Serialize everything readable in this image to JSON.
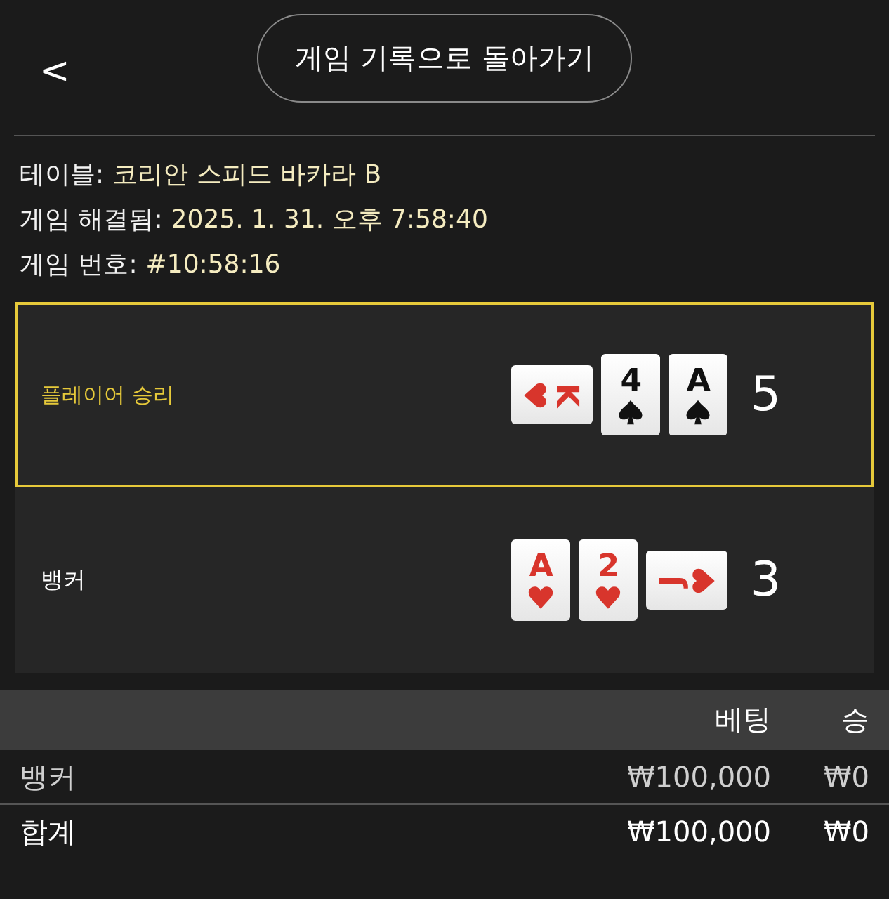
{
  "header": {
    "back": "<",
    "title": "게임 기록으로 돌아가기"
  },
  "info": [
    {
      "label": "테이블:",
      "value": "코리안 스피드 바카라 B"
    },
    {
      "label": "게임 해결됨:",
      "value": "2025. 1. 31. 오후 7:58:40"
    },
    {
      "label": "게임 번호:",
      "value": "#10:58:16"
    }
  ],
  "hands": [
    {
      "name": "플레이어 승리",
      "winner": true,
      "score": "5",
      "cards": [
        {
          "rank": "K",
          "kind": "heart",
          "turned_right": true,
          "turned_left": false
        },
        {
          "rank": "4",
          "kind": "spade",
          "turned_right": false,
          "turned_left": false
        },
        {
          "rank": "A",
          "kind": "spade",
          "turned_right": false,
          "turned_left": false
        }
      ]
    },
    {
      "name": "뱅커",
      "winner": false,
      "score": "3",
      "cards": [
        {
          "rank": "A",
          "kind": "heart",
          "turned_right": false,
          "turned_left": false
        },
        {
          "rank": "2",
          "kind": "heart",
          "turned_right": false,
          "turned_left": false
        },
        {
          "rank": "J",
          "kind": "heart",
          "turned_right": false,
          "turned_left": true
        }
      ]
    }
  ],
  "bets": {
    "columns": [
      "베팅",
      "승"
    ],
    "rows": [
      {
        "kind": "bet",
        "label": "뱅커",
        "values": [
          "₩100,000",
          "₩0"
        ]
      },
      {
        "kind": "total",
        "label": "합계",
        "values": [
          "₩100,000",
          "₩0"
        ]
      }
    ]
  }
}
